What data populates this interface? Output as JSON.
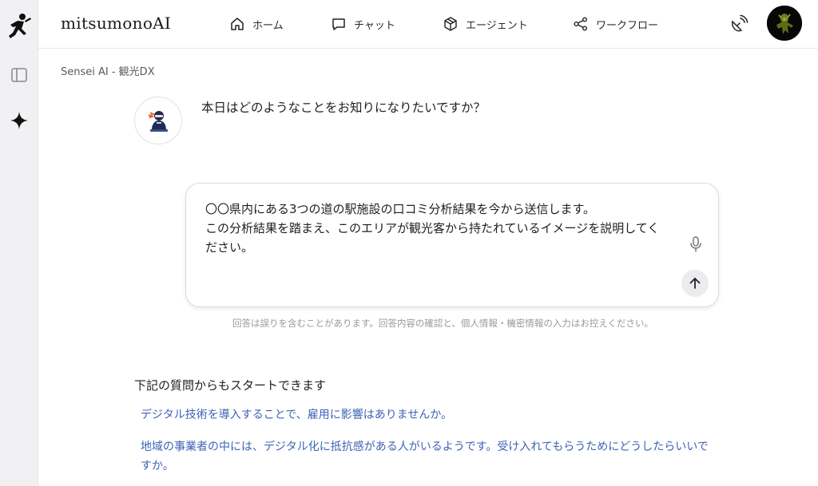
{
  "header": {
    "brand": "mitsumonoAI",
    "nav": [
      {
        "label": "ホーム",
        "icon": "home-icon"
      },
      {
        "label": "チャット",
        "icon": "chat-icon"
      },
      {
        "label": "エージェント",
        "icon": "box-icon"
      },
      {
        "label": "ワークフロー",
        "icon": "share-icon"
      }
    ],
    "right_icon": "satellite-dish-icon"
  },
  "sidebar": {
    "items": [
      {
        "icon": "runner-logo-icon"
      },
      {
        "icon": "sidebar-toggle-icon"
      },
      {
        "icon": "sparkle-icon"
      }
    ]
  },
  "breadcrumb": "Sensei AI - 観光DX",
  "assistant": {
    "message": "本日はどのようなことをお知りになりたいですか？"
  },
  "composer": {
    "text": "〇〇県内にある3つの道の駅施設の口コミ分析結果を今から送信します。\nこの分析結果を踏まえ、このエリアが観光客から持たれているイメージを説明してください。"
  },
  "disclaimer": "回答は誤りを含むことがあります。回答内容の確認と、個人情報・機密情報の入力はお控えください。",
  "suggestions": {
    "title": "下記の質問からもスタートできます",
    "items": [
      "デジタル技術を導入することで、雇用に影響はありませんか。",
      "地域の事業者の中には、デジタル化に抵抗感がある人がいるようです。受け入れてもらうためにどうしたらいいですか。"
    ]
  },
  "colors": {
    "link": "#3d63b5",
    "rail_bg": "#f1f1f3"
  }
}
